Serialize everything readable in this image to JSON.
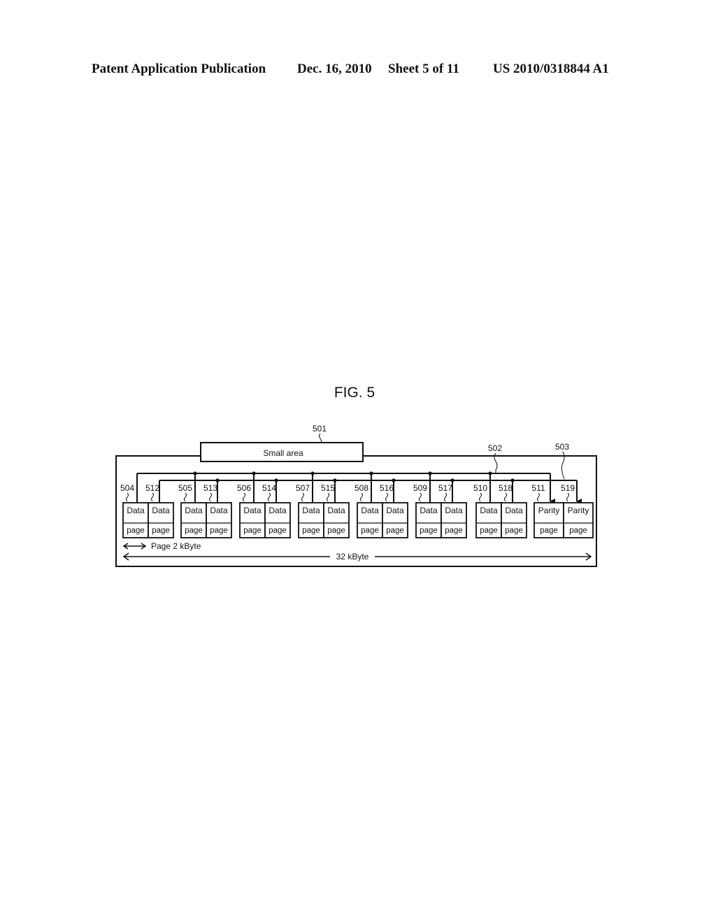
{
  "header": {
    "publication": "Patent Application Publication",
    "date": "Dec. 16, 2010",
    "sheet": "Sheet 5 of 11",
    "number": "US 2010/0318844 A1"
  },
  "figure": {
    "title": "FIG. 5",
    "small_area": {
      "ref": "501",
      "label": "Small area"
    },
    "bus_refs": {
      "first": "502",
      "second": "503"
    },
    "page_groups": [
      {
        "pages": [
          {
            "ref": "504",
            "top": "Data",
            "bottom": "page"
          },
          {
            "ref": "512",
            "top": "Data",
            "bottom": "page"
          }
        ]
      },
      {
        "pages": [
          {
            "ref": "505",
            "top": "Data",
            "bottom": "page"
          },
          {
            "ref": "513",
            "top": "Data",
            "bottom": "page"
          }
        ]
      },
      {
        "pages": [
          {
            "ref": "506",
            "top": "Data",
            "bottom": "page"
          },
          {
            "ref": "514",
            "top": "Data",
            "bottom": "page"
          }
        ]
      },
      {
        "pages": [
          {
            "ref": "507",
            "top": "Data",
            "bottom": "page"
          },
          {
            "ref": "515",
            "top": "Data",
            "bottom": "page"
          }
        ]
      },
      {
        "pages": [
          {
            "ref": "508",
            "top": "Data",
            "bottom": "page"
          },
          {
            "ref": "516",
            "top": "Data",
            "bottom": "page"
          }
        ]
      },
      {
        "pages": [
          {
            "ref": "509",
            "top": "Data",
            "bottom": "page"
          },
          {
            "ref": "517",
            "top": "Data",
            "bottom": "page"
          }
        ]
      },
      {
        "pages": [
          {
            "ref": "510",
            "top": "Data",
            "bottom": "page"
          },
          {
            "ref": "518",
            "top": "Data",
            "bottom": "page"
          }
        ]
      },
      {
        "pages": [
          {
            "ref": "511",
            "top": "Parity",
            "bottom": "page"
          },
          {
            "ref": "519",
            "top": "Parity",
            "bottom": "page"
          }
        ]
      }
    ],
    "page_size_label": "Page 2 kByte",
    "total_size_label": "32 kByte"
  }
}
